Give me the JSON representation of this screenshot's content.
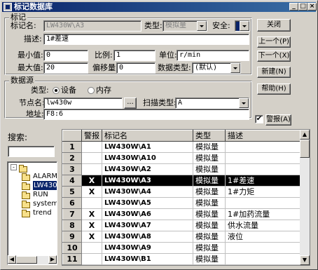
{
  "window": {
    "title": "标记数据库"
  },
  "titlebar_buttons": {
    "minimize": "_",
    "maximize": "□",
    "close": "×"
  },
  "tag_group": {
    "title": "标记",
    "tag_name_label": "标记名:",
    "tag_name_value": "LW430W\\A3",
    "type_label": "类型:",
    "type_value": "模拟量",
    "security_label": "安全:",
    "security_value": "",
    "description_label": "描述:",
    "description_value": "1#差速",
    "min_label": "最小值:",
    "min_value": "0",
    "max_label": "最大值:",
    "max_value": "20",
    "scale_label": "比例:",
    "scale_value": "1",
    "offset_label": "偏移量:",
    "offset_value": "0",
    "unit_label": "单位:",
    "unit_value": "r/min",
    "datatype_label": "数据类型:",
    "datatype_value": "(默认)"
  },
  "source_group": {
    "title": "数据源",
    "type_label": "类型:",
    "radio_device": "设备",
    "radio_memory": "内存",
    "node_label": "节点名:",
    "node_value": "lw430w",
    "browse_label": "...",
    "scan_label": "扫描类型:",
    "scan_value": "A",
    "address_label": "地址:",
    "address_value": "F8:6"
  },
  "buttons": {
    "close": "关闭",
    "prev": "上一个(P)",
    "next": "下一个(X)",
    "new": "新建(N)",
    "help": "帮助(H)"
  },
  "alarm_checkbox": {
    "label": "警报(A)",
    "checked": true,
    "mark": "✔"
  },
  "search": {
    "label": "搜索:",
    "value": ""
  },
  "tree": {
    "root_expander": "-",
    "items": [
      "ALARM",
      "LW430",
      "RUN",
      "system",
      "trend"
    ],
    "selected_index": 1
  },
  "table": {
    "columns": [
      "",
      "警报",
      "标记名",
      "类型",
      "描述"
    ],
    "selected_row": 3,
    "rows": [
      {
        "num": "1",
        "alarm": "",
        "name": "LW430W\\A1",
        "type": "模拟量",
        "desc": ""
      },
      {
        "num": "2",
        "alarm": "",
        "name": "LW430W\\A10",
        "type": "模拟量",
        "desc": ""
      },
      {
        "num": "3",
        "alarm": "",
        "name": "LW430W\\A2",
        "type": "模拟量",
        "desc": ""
      },
      {
        "num": "4",
        "alarm": "X",
        "name": "LW430W\\A3",
        "type": "模拟量",
        "desc": "1#差速"
      },
      {
        "num": "5",
        "alarm": "X",
        "name": "LW430W\\A4",
        "type": "模拟量",
        "desc": "1#力矩"
      },
      {
        "num": "6",
        "alarm": "",
        "name": "LW430W\\A5",
        "type": "模拟量",
        "desc": ""
      },
      {
        "num": "7",
        "alarm": "X",
        "name": "LW430W\\A6",
        "type": "模拟量",
        "desc": "1#加药流量"
      },
      {
        "num": "8",
        "alarm": "X",
        "name": "LW430W\\A7",
        "type": "模拟量",
        "desc": "供水流量"
      },
      {
        "num": "9",
        "alarm": "X",
        "name": "LW430W\\A8",
        "type": "模拟量",
        "desc": "液位"
      },
      {
        "num": "10",
        "alarm": "",
        "name": "LW430W\\A9",
        "type": "模拟量",
        "desc": ""
      },
      {
        "num": "11",
        "alarm": "",
        "name": "LW430W\\B1",
        "type": "模拟量",
        "desc": ""
      }
    ]
  },
  "colors": {
    "titlebar": "#0a246a",
    "face": "#d4d0c8",
    "selection": "#000000"
  }
}
